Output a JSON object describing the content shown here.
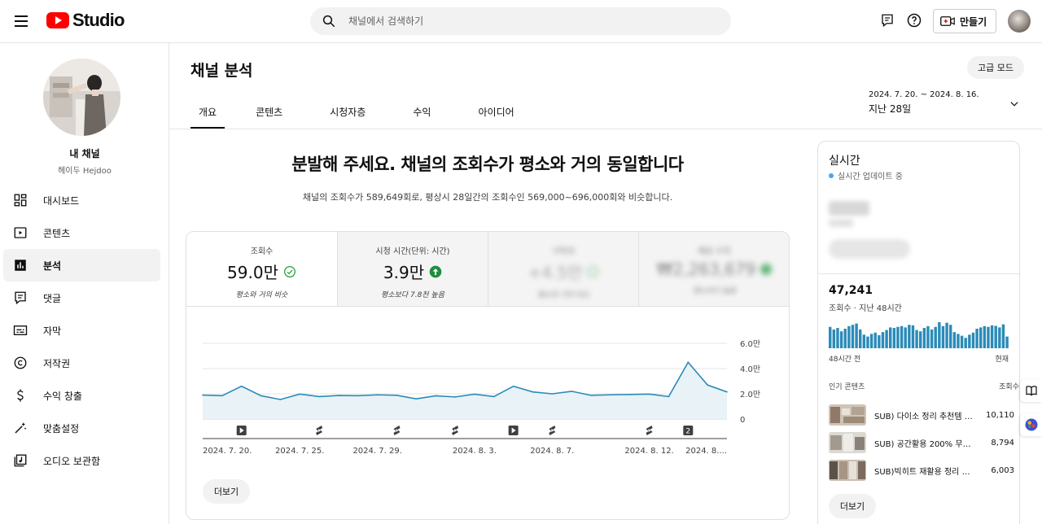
{
  "header": {
    "logo_text": "Studio",
    "search_placeholder": "채널에서 검색하기",
    "create_label": "만들기"
  },
  "sidebar": {
    "channel_name": "내 채널",
    "channel_handle": "헤이두 Hejdoo",
    "items": [
      {
        "label": "대시보드",
        "icon": "dashboard-icon"
      },
      {
        "label": "콘텐츠",
        "icon": "content-icon"
      },
      {
        "label": "분석",
        "icon": "analytics-icon",
        "active": true
      },
      {
        "label": "댓글",
        "icon": "comments-icon"
      },
      {
        "label": "자막",
        "icon": "subtitles-icon"
      },
      {
        "label": "저작권",
        "icon": "copyright-icon"
      },
      {
        "label": "수익 창출",
        "icon": "monetization-icon"
      },
      {
        "label": "맞춤설정",
        "icon": "customization-icon"
      },
      {
        "label": "오디오 보관함",
        "icon": "audio-library-icon"
      }
    ]
  },
  "main": {
    "title": "채널 분석",
    "advanced_label": "고급 모드",
    "tabs": [
      "개요",
      "콘텐츠",
      "시청자층",
      "수익",
      "아이디어"
    ],
    "active_tab": 0,
    "date_range": "2024. 7. 20. ~ 2024. 8. 16.",
    "date_period": "지난 28일",
    "headline": "분발해 주세요. 채널의 조회수가 평소와 거의 동일합니다",
    "subline": "채널의 조회수가 589,649회로, 평상시 28일간의 조회수인 569,000~696,000회와 비슷합니다.",
    "metrics": [
      {
        "label": "조회수",
        "value": "59.0만",
        "note": "평소와 거의 비슷",
        "status": "check"
      },
      {
        "label": "시청 시간(단위: 시간)",
        "value": "3.9만",
        "note": "평소보다 7.8천 높음",
        "status": "up"
      },
      {
        "label": "구독자",
        "value": "+4.5만",
        "note": "평소와 거의 비슷",
        "status": "blurred"
      },
      {
        "label": "예상 수익",
        "value": "₩2,263,679",
        "note": "평소보다 높음",
        "status": "blurred"
      }
    ],
    "more_label": "더보기"
  },
  "chart_data": {
    "type": "area",
    "x": [
      "2024. 7. 20.",
      "2024. 7. 21.",
      "2024. 7. 22.",
      "2024. 7. 23.",
      "2024. 7. 24.",
      "2024. 7. 25.",
      "2024. 7. 26.",
      "2024. 7. 27.",
      "2024. 7. 28.",
      "2024. 7. 29.",
      "2024. 7. 30.",
      "2024. 7. 31.",
      "2024. 8. 1.",
      "2024. 8. 2.",
      "2024. 8. 3.",
      "2024. 8. 4.",
      "2024. 8. 5.",
      "2024. 8. 6.",
      "2024. 8. 7.",
      "2024. 8. 8.",
      "2024. 8. 9.",
      "2024. 8. 10.",
      "2024. 8. 11.",
      "2024. 8. 12.",
      "2024. 8. 13.",
      "2024. 8. 14.",
      "2024. 8. 15.",
      "2024. 8. 16."
    ],
    "values": [
      19000,
      18500,
      26000,
      18500,
      15500,
      19800,
      17800,
      18700,
      18500,
      19200,
      18800,
      16000,
      18400,
      17500,
      19700,
      17800,
      26000,
      21500,
      20000,
      22000,
      18800,
      19200,
      19500,
      19800,
      17800,
      45000,
      27000,
      21500
    ],
    "xtick_labels": [
      "2024. 7. 20.",
      "2024. 7. 25.",
      "2024. 7. 29.",
      "2024. 8. 3.",
      "2024. 8. 7.",
      "2024. 8. 12.",
      "2024. 8...."
    ],
    "ytick_labels": [
      "0",
      "2.0만",
      "4.0만",
      "6.0만"
    ],
    "ylim": [
      0,
      60000
    ],
    "grid": true,
    "markers": [
      {
        "x": "2024. 7. 22.",
        "kind": "video"
      },
      {
        "x": "2024. 7. 26.",
        "kind": "short"
      },
      {
        "x": "2024. 7. 30.",
        "kind": "short"
      },
      {
        "x": "2024. 8. 2.",
        "kind": "short"
      },
      {
        "x": "2024. 8. 5.",
        "kind": "video"
      },
      {
        "x": "2024. 8. 7.",
        "kind": "short"
      },
      {
        "x": "2024. 8. 12.",
        "kind": "short"
      },
      {
        "x": "2024. 8. 14.",
        "kind": "count",
        "label": "2"
      }
    ],
    "line_color": "#2a8bb8",
    "fill_color": "#e8f2f7"
  },
  "realtime": {
    "title": "실시간",
    "live_label": "실시간 업데이트 중",
    "views_48h": "47,241",
    "views_48h_label": "조회수 · 지난 48시간",
    "bars": [
      0.82,
      0.72,
      0.78,
      0.65,
      0.75,
      0.85,
      0.9,
      0.95,
      0.72,
      0.52,
      0.45,
      0.55,
      0.6,
      0.5,
      0.62,
      0.7,
      0.8,
      0.78,
      0.82,
      0.85,
      0.8,
      0.9,
      0.88,
      0.7,
      0.65,
      0.78,
      0.85,
      0.72,
      0.82,
      1.0,
      0.85,
      0.98,
      0.9,
      0.62,
      0.55,
      0.48,
      0.4,
      0.52,
      0.6,
      0.75,
      0.8,
      0.85,
      0.82,
      0.88,
      0.86,
      0.8,
      0.92,
      0.45
    ],
    "bars_color": "#2a8bb8",
    "axis_left": "48시간 전",
    "axis_right": "현재",
    "popular_header": "인기 콘텐츠",
    "popular_header_right": "조회수",
    "popular": [
      {
        "title": "SUB) 다이소 정리 추천템 3...",
        "views": "10,110"
      },
      {
        "title": "SUB) 공간활용 200% 무타...",
        "views": "8,794"
      },
      {
        "title": "SUB)빅히트 재활용 정리 수...",
        "views": "6,003"
      }
    ],
    "more_label": "더보기"
  }
}
